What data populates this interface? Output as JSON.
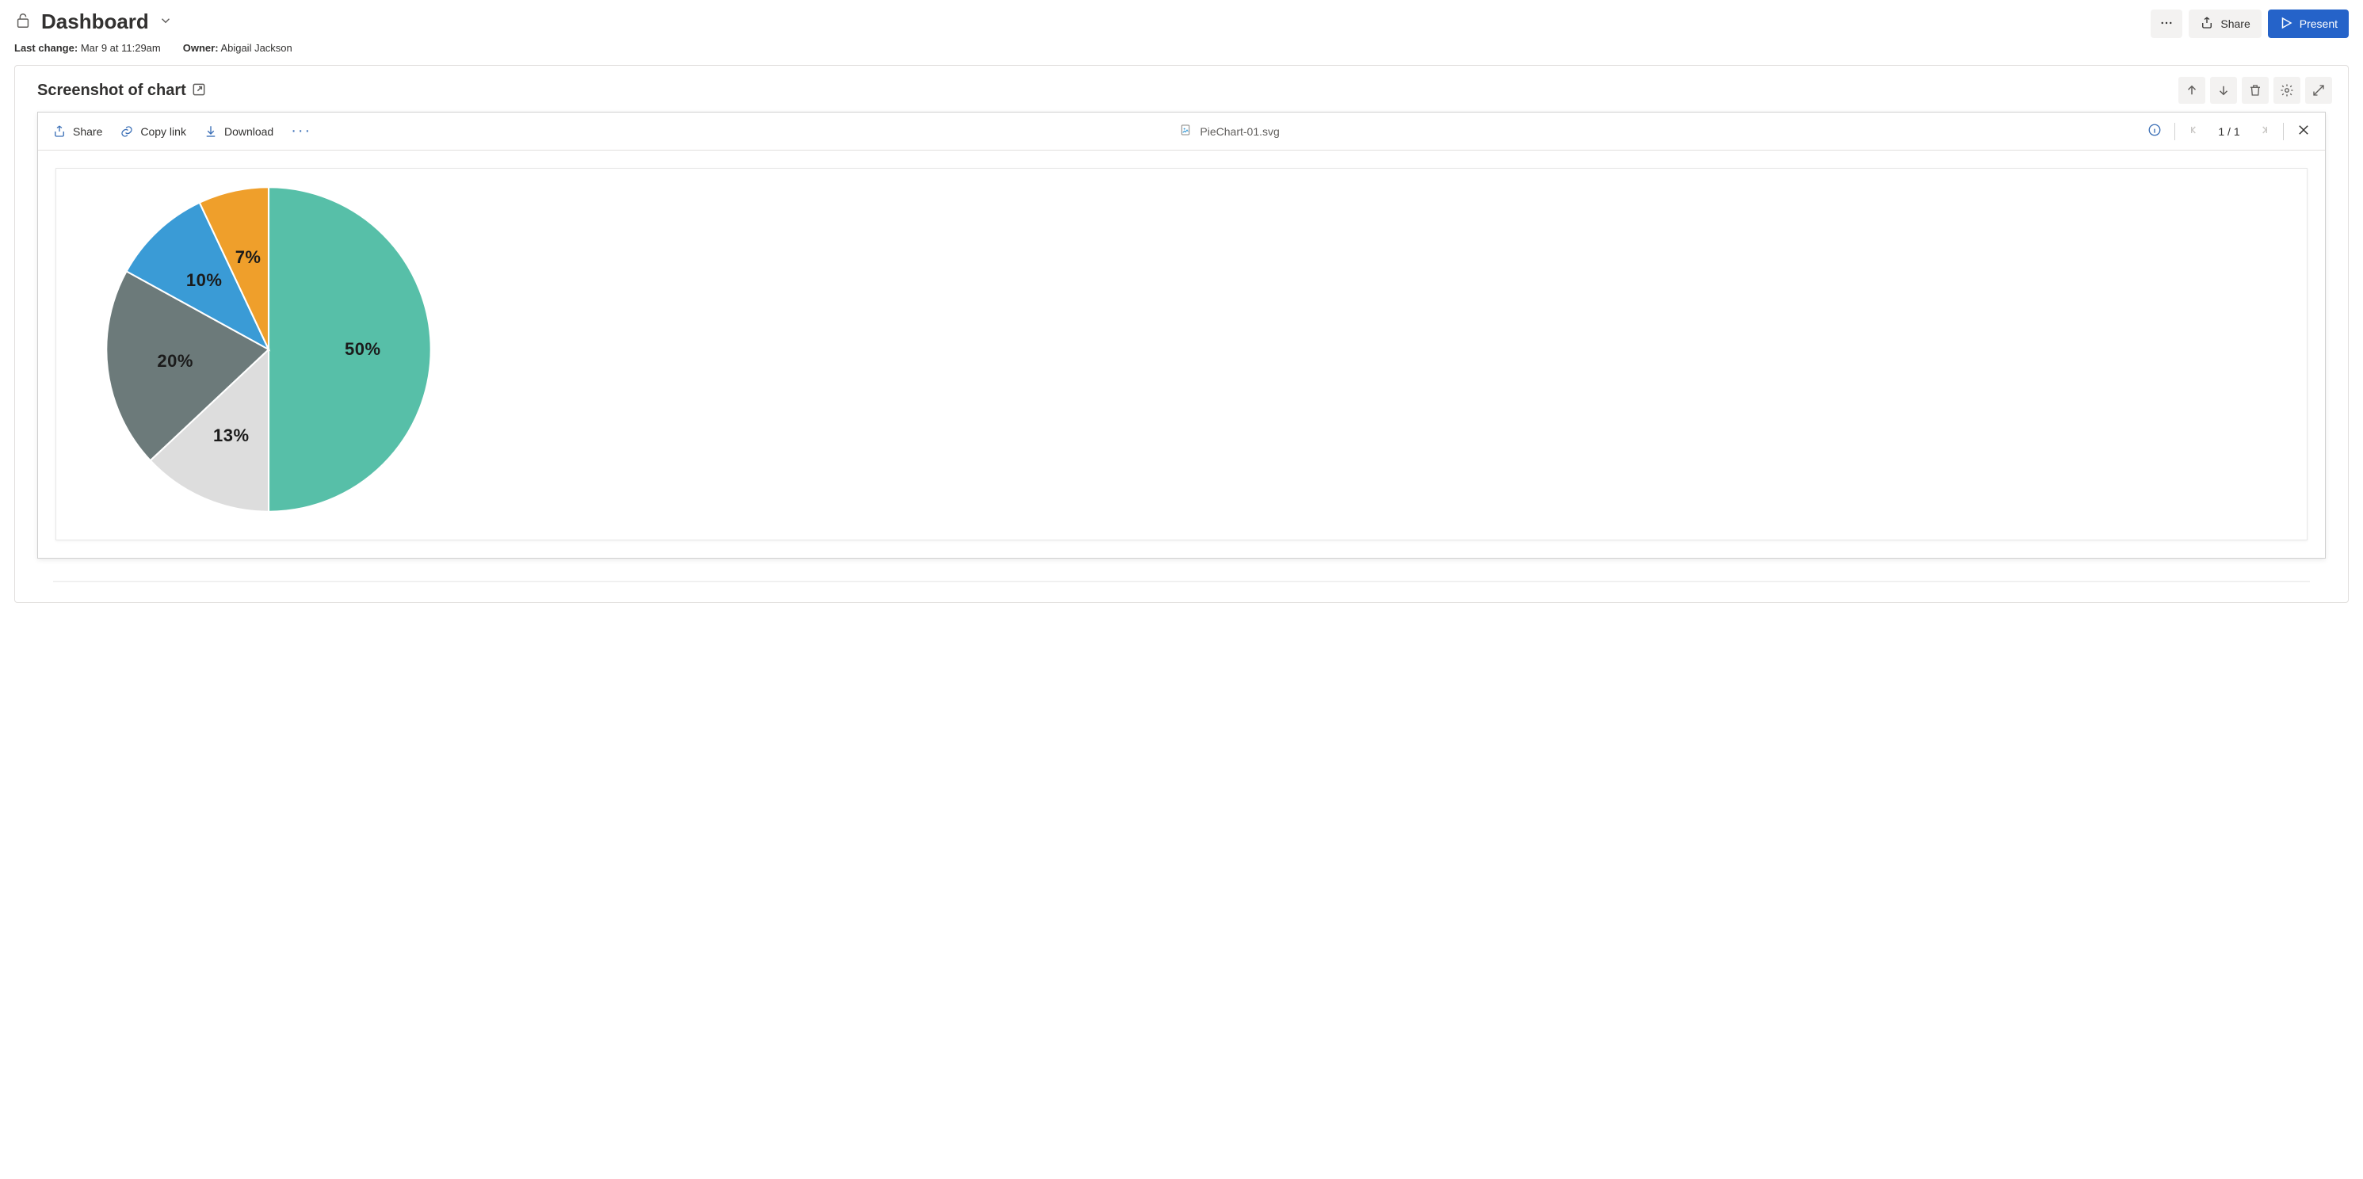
{
  "header": {
    "title": "Dashboard",
    "last_change_label": "Last change:",
    "last_change_value": "Mar 9 at 11:29am",
    "owner_label": "Owner:",
    "owner_value": "Abigail Jackson",
    "share_label": "Share",
    "present_label": "Present"
  },
  "panel": {
    "title": "Screenshot of chart"
  },
  "viewer": {
    "share_label": "Share",
    "copy_link_label": "Copy link",
    "download_label": "Download",
    "filename": "PieChart-01.svg",
    "page_counter": "1 / 1"
  },
  "chart_data": {
    "type": "pie",
    "title": "",
    "series": [
      {
        "label": "50%",
        "value": 50,
        "color": "#57bfa8"
      },
      {
        "label": "13%",
        "value": 13,
        "color": "#dddddd"
      },
      {
        "label": "20%",
        "value": 20,
        "color": "#6c7a7a"
      },
      {
        "label": "10%",
        "value": 10,
        "color": "#3a9bd6"
      },
      {
        "label": "7%",
        "value": 7,
        "color": "#ef9f2b"
      }
    ]
  }
}
